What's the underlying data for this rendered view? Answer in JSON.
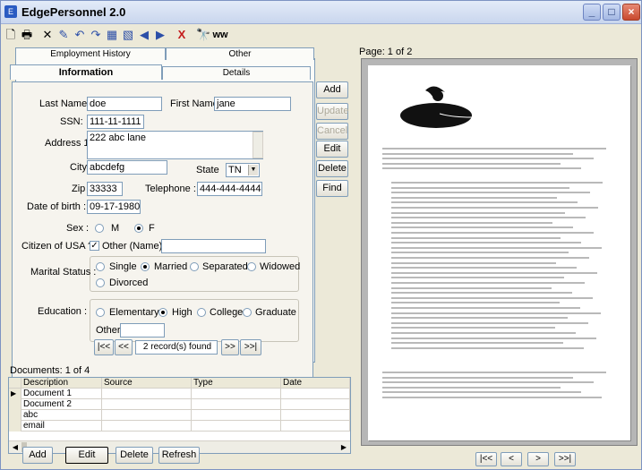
{
  "window": {
    "title": "EdgePersonnel 2.0",
    "minimize_glyph": "_",
    "maximize_glyph": "□",
    "close_glyph": "×"
  },
  "toolbar": {
    "icons": [
      "new-icon",
      "print-icon",
      "delete-icon",
      "edit-icon",
      "undo-icon",
      "redo-icon",
      "image-icon",
      "image-add-icon",
      "prev-icon",
      "next-icon",
      "remove-icon",
      "find-icon",
      "scan-icon"
    ],
    "glyphs": {
      "new": "🗋",
      "print": "🖶",
      "delete": "✕",
      "edit": "✎",
      "undo": "↶",
      "redo": "↷",
      "image": "▦",
      "image_add": "▧",
      "prev": "◀",
      "next": "▶",
      "remove": "X",
      "find": "🔭",
      "scan": "ww"
    }
  },
  "tabs": {
    "back_left": "Employment History",
    "back_right": "Other",
    "front_active": "Information",
    "front_other": "Details"
  },
  "form": {
    "last_name_label": "Last Name",
    "last_name_value": "doe",
    "first_name_label": "First Name",
    "first_name_value": "jane",
    "ssn_label": "SSN:",
    "ssn_value": "111-11-1111",
    "address_label": "Address 1",
    "address_value": "222 abc lane",
    "city_label": "City:",
    "city_value": "abcdefg",
    "state_label": "State",
    "state_value": "TN",
    "zip_label": "Zip",
    "zip_value": "33333",
    "telephone_label": "Telephone :",
    "telephone_value": "444-444-4444",
    "dob_label": "Date of birth :",
    "dob_value": "09-17-1980",
    "sex_label": "Sex :",
    "sex_options": [
      "M",
      "F"
    ],
    "sex_selected": "F",
    "citizen_label": "Citizen of USA ?",
    "citizen_other": "Other (Name)",
    "marital_label": "Marital Status :",
    "marital_options": [
      "Single",
      "Married",
      "Separated",
      "Widowed",
      "Divorced"
    ],
    "marital_selected": "Married",
    "education_label": "Education :",
    "education_options": [
      "Elementary",
      "High",
      "College",
      "Graduate"
    ],
    "education_selected": "High",
    "education_other": "Other"
  },
  "actions": {
    "add": "Add",
    "update": "Update",
    "cancel": "Cancel",
    "edit": "Edit",
    "delete": "Delete",
    "find": "Find"
  },
  "record_nav": {
    "first": "|<<",
    "prev": "<<",
    "status": "2 record(s) found",
    "next": ">>",
    "last": ">>|"
  },
  "documents": {
    "header": "Documents: 1 of 4",
    "columns": [
      "Description",
      "Source",
      "Type",
      "Date"
    ],
    "rows": [
      "Document 1",
      "Document 2",
      "abc",
      "email"
    ],
    "buttons": {
      "add": "Add",
      "edit": "Edit",
      "delete": "Delete",
      "refresh": "Refresh"
    }
  },
  "viewer": {
    "page_label": "Page: 1 of 2",
    "nav": {
      "first": "|<<",
      "prev": "<",
      "next": ">",
      "last": ">>|"
    }
  }
}
